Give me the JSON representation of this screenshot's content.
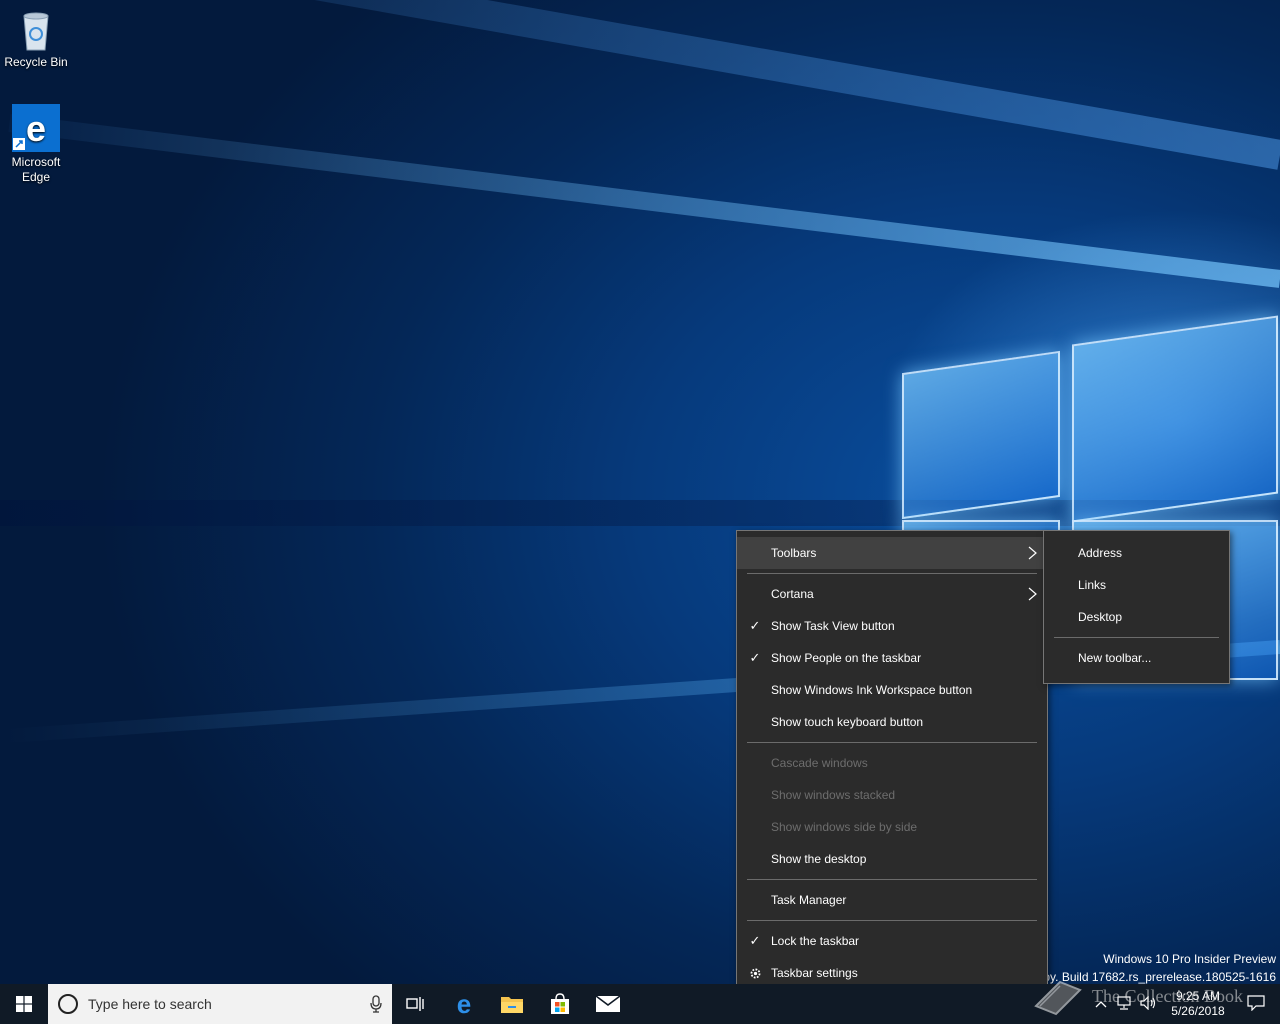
{
  "desktop": {
    "icons": [
      {
        "label": "Recycle Bin",
        "icon": "recycle-bin-icon"
      },
      {
        "label": "Microsoft Edge",
        "icon": "edge-icon"
      }
    ]
  },
  "context_menu": {
    "items": [
      {
        "label": "Toolbars",
        "checked": false,
        "submenu": true,
        "state": "hover"
      },
      {
        "label": "Cortana",
        "checked": false,
        "submenu": true
      },
      {
        "label": "Show Task View button",
        "checked": true
      },
      {
        "label": "Show People on the taskbar",
        "checked": true
      },
      {
        "label": "Show Windows Ink Workspace button",
        "checked": false
      },
      {
        "label": "Show touch keyboard button",
        "checked": false
      },
      {
        "label": "Cascade windows",
        "disabled": true
      },
      {
        "label": "Show windows stacked",
        "disabled": true
      },
      {
        "label": "Show windows side by side",
        "disabled": true
      },
      {
        "label": "Show the desktop"
      },
      {
        "label": "Task Manager"
      },
      {
        "label": "Lock the taskbar",
        "checked": true
      },
      {
        "label": "Taskbar settings",
        "icon": "gear-icon"
      }
    ],
    "check_glyph": "✓"
  },
  "toolbars_submenu": {
    "items": [
      "Address",
      "Links",
      "Desktop",
      "New toolbar..."
    ]
  },
  "taskbar": {
    "search_placeholder": "Type here to search",
    "pinned": [
      "task-view-icon",
      "edge-icon",
      "file-explorer-icon",
      "store-icon",
      "mail-icon"
    ],
    "clock_time": "9:25 AM",
    "clock_date": "5/26/2018"
  },
  "watermark": {
    "line1": "Windows 10 Pro Insider Preview",
    "line2": "opy. Build 17682.rs_prerelease.180525-1616",
    "overlay": "The Collection Book"
  },
  "colors": {
    "menu_bg": "#2b2b2b",
    "menu_hover": "#414141",
    "taskbar_bg": "#101a26",
    "accent": "#0078d7"
  }
}
